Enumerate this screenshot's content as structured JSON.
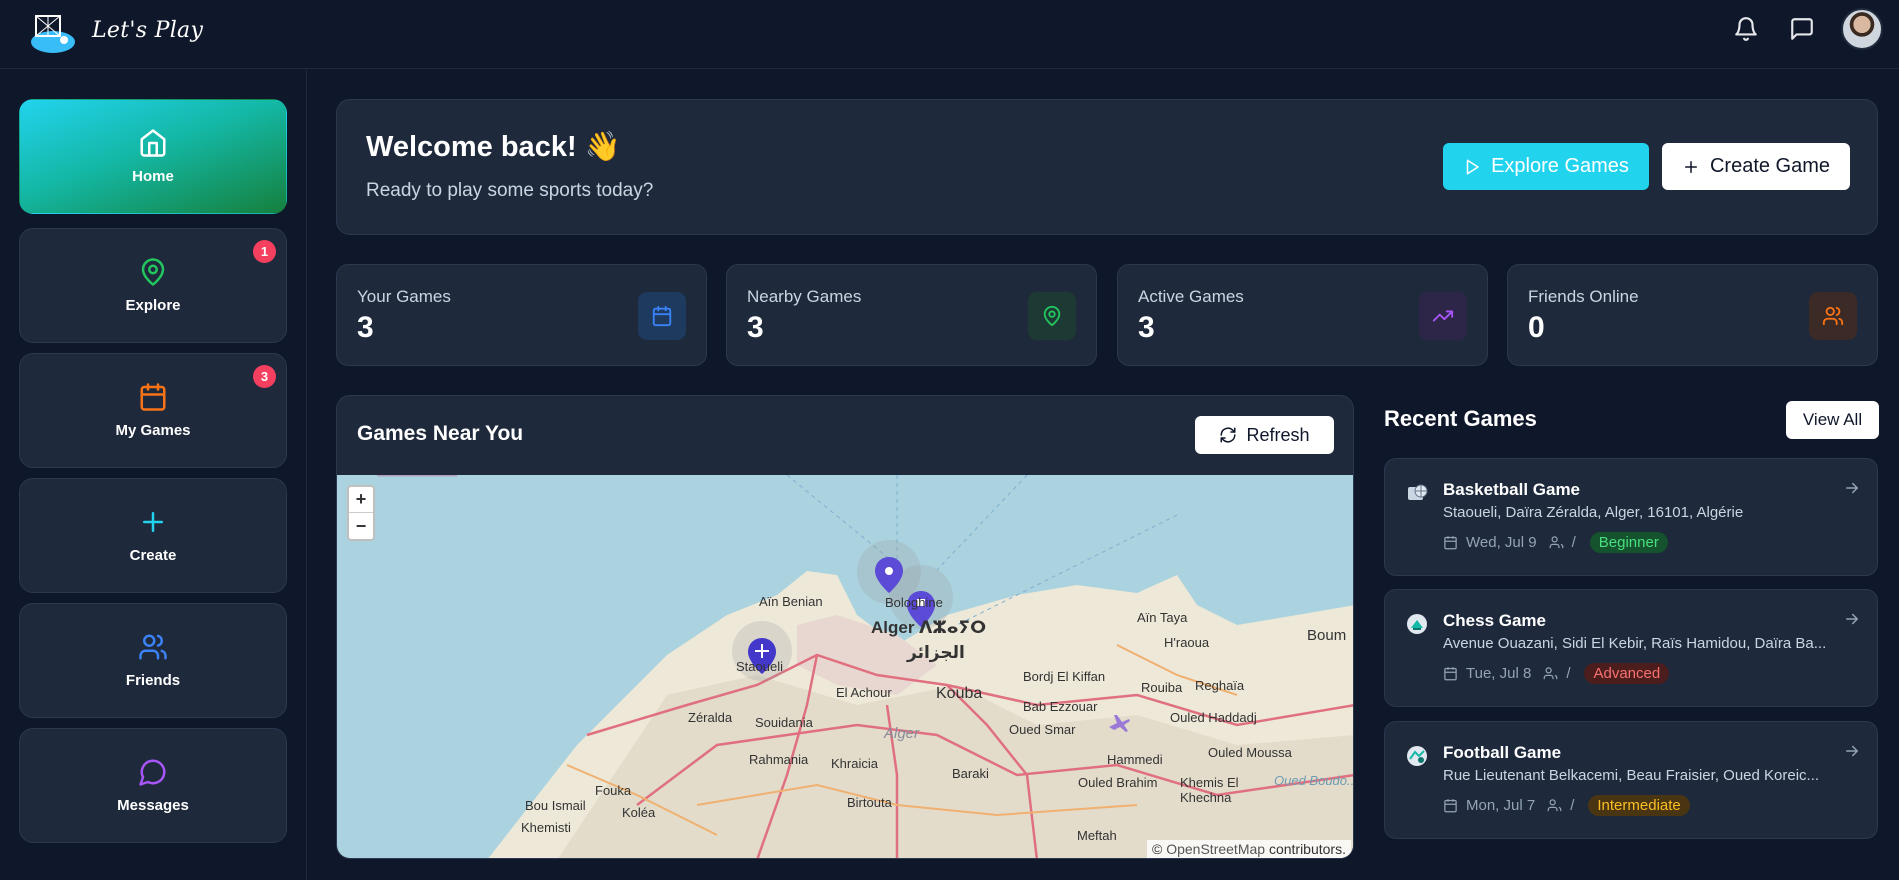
{
  "app": {
    "brand": "Let's Play"
  },
  "header": {
    "icons": [
      "bell-icon",
      "message-icon"
    ]
  },
  "sidebar": {
    "items": [
      {
        "label": "Home",
        "icon": "home-icon",
        "active": true,
        "badge": ""
      },
      {
        "label": "Explore",
        "icon": "map-pin-icon",
        "active": false,
        "badge": "1"
      },
      {
        "label": "My Games",
        "icon": "calendar-icon",
        "active": false,
        "badge": "3"
      },
      {
        "label": "Create",
        "icon": "plus-icon",
        "active": false,
        "badge": ""
      },
      {
        "label": "Friends",
        "icon": "users-icon",
        "active": false,
        "badge": ""
      },
      {
        "label": "Messages",
        "icon": "chat-icon",
        "active": false,
        "badge": ""
      }
    ]
  },
  "welcome": {
    "title": "Welcome back! 👋",
    "subtitle": "Ready to play some sports today?",
    "explore_label": "Explore Games",
    "create_label": "Create Game"
  },
  "stats": [
    {
      "label": "Your Games",
      "value": "3",
      "icon": "calendar-icon",
      "color": "#3b82f6"
    },
    {
      "label": "Nearby Games",
      "value": "3",
      "icon": "map-pin-icon",
      "color": "#22c55e"
    },
    {
      "label": "Active Games",
      "value": "3",
      "icon": "trending-up-icon",
      "color": "#a855f7"
    },
    {
      "label": "Friends Online",
      "value": "0",
      "icon": "users-icon",
      "color": "#f97316"
    }
  ],
  "near": {
    "title": "Games Near You",
    "refresh_label": "Refresh",
    "zoom_in": "+",
    "zoom_out": "−",
    "attribution_prefix": "© ",
    "attribution_link": "OpenStreetMap",
    "attribution_suffix": " contributors.",
    "labels": {
      "ain_benian": "Aïn Benian",
      "bologhine": "Bologhine",
      "alger": "Alger ⴷⵣⴰⵢⵔ",
      "alger_ar": "الجزائر",
      "staoueli": "Staoueli",
      "el_achour": "El Achour",
      "kouba": "Kouba",
      "bordj": "Bordj El Kiffan",
      "ain_taya": "Aïn Taya",
      "hraoua": "H'raoua",
      "boum": "Boum",
      "rouiba": "Rouiba",
      "reghaia": "Reghaïa",
      "zeralda": "Zéralda",
      "souidania": "Souidania",
      "bab_ezzouar": "Bab Ezzouar",
      "oued_smar": "Oued Smar",
      "ouled_haddadj": "Ouled Haddadj",
      "alger_region": "Alger",
      "rahmania": "Rahmania",
      "khraicia": "Khraicia",
      "hammedi": "Hammedi",
      "ouled_moussa": "Ouled Moussa",
      "baraki": "Baraki",
      "ouled_brahim": "Ouled Brahim",
      "khemis": "Khemis El Khechna",
      "fouka": "Fouka",
      "birtouta": "Birtouta",
      "bou_ismail": "Bou Ismail",
      "kolea": "Koléa",
      "khemisti": "Khemisti",
      "meftah": "Meftah",
      "oued_boudouaou": "Oued Boudo..."
    }
  },
  "recent": {
    "title": "Recent Games",
    "view_all_label": "View All",
    "games": [
      {
        "name": "Basketball Game",
        "address": "Staoueli, Daïra Zéralda, Alger, 16101, Algérie",
        "date": "Wed, Jul 9",
        "players": "/",
        "level": "Beginner",
        "icon": "basketball-icon"
      },
      {
        "name": "Chess Game",
        "address": "Avenue Ouazani, Sidi El Kebir, Raïs Hamidou, Daïra Ba...",
        "date": "Tue, Jul 8",
        "players": "/",
        "level": "Advanced",
        "icon": "chess-icon"
      },
      {
        "name": "Football Game",
        "address": "Rue Lieutenant Belkacemi, Beau Fraisier, Oued Koreic...",
        "date": "Mon, Jul 7",
        "players": "/",
        "level": "Intermediate",
        "icon": "football-icon"
      }
    ]
  }
}
